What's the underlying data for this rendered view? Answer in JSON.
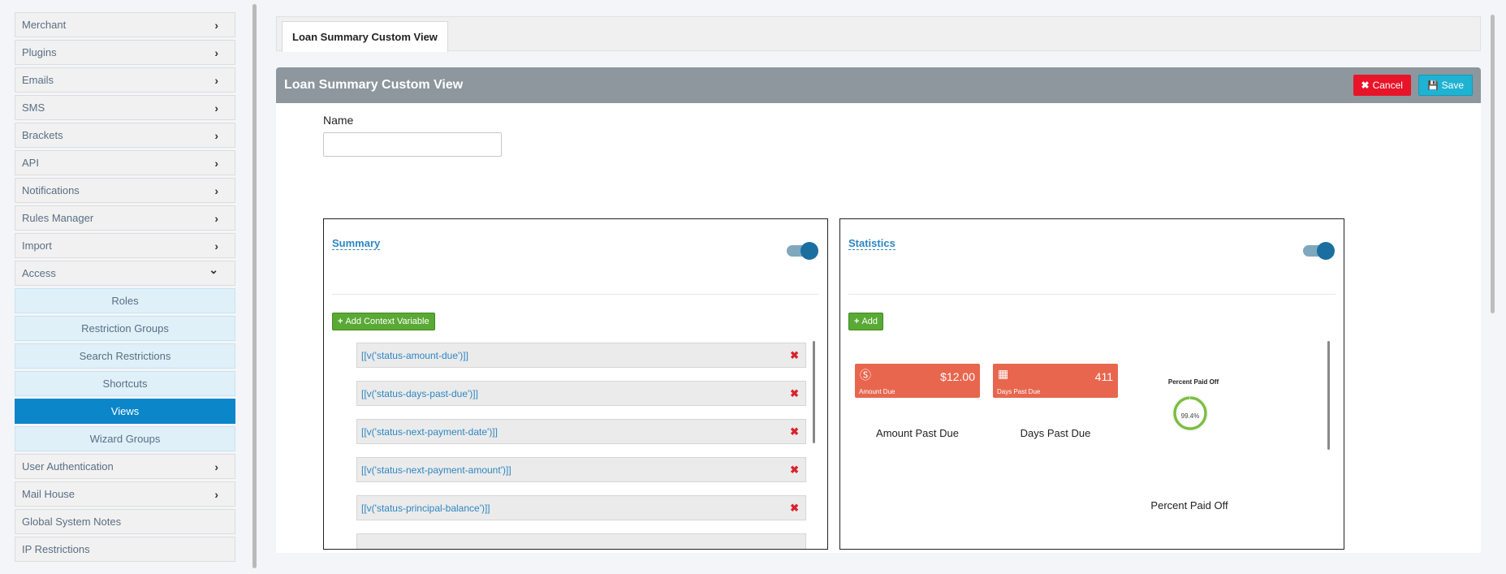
{
  "sidebar": {
    "items": [
      {
        "label": "Merchant",
        "type": "menu",
        "expand_icon": "chevron-right"
      },
      {
        "label": "Plugins",
        "type": "menu",
        "expand_icon": "chevron-right"
      },
      {
        "label": "Emails",
        "type": "menu",
        "expand_icon": "chevron-right"
      },
      {
        "label": "SMS",
        "type": "menu",
        "expand_icon": "chevron-right"
      },
      {
        "label": "Brackets",
        "type": "menu",
        "expand_icon": "chevron-right"
      },
      {
        "label": "API",
        "type": "menu",
        "expand_icon": "chevron-right"
      },
      {
        "label": "Notifications",
        "type": "menu",
        "expand_icon": "chevron-right"
      },
      {
        "label": "Rules Manager",
        "type": "menu",
        "expand_icon": "chevron-right"
      },
      {
        "label": "Import",
        "type": "menu",
        "expand_icon": "chevron-right"
      },
      {
        "label": "Access",
        "type": "menu",
        "expand_icon": "chevron-down"
      },
      {
        "label": "Roles",
        "type": "sub"
      },
      {
        "label": "Restriction Groups",
        "type": "sub"
      },
      {
        "label": "Search Restrictions",
        "type": "sub"
      },
      {
        "label": "Shortcuts",
        "type": "sub"
      },
      {
        "label": "Views",
        "type": "sub",
        "active": true
      },
      {
        "label": "Wizard Groups",
        "type": "sub"
      },
      {
        "label": "User Authentication",
        "type": "menu",
        "expand_icon": "chevron-right"
      },
      {
        "label": "Mail House",
        "type": "menu",
        "expand_icon": "chevron-right"
      },
      {
        "label": "Global System Notes",
        "type": "menu"
      },
      {
        "label": "IP Restrictions",
        "type": "menu"
      }
    ]
  },
  "tabs": [
    {
      "label": "Loan Summary Custom View",
      "active": true
    }
  ],
  "panel": {
    "title": "Loan Summary Custom View",
    "cancel_label": "Cancel",
    "save_label": "Save",
    "name_label": "Name",
    "name_value": ""
  },
  "summary": {
    "title": "Summary",
    "enabled": true,
    "add_button": "Add Context Variable",
    "variables": [
      "[[v('status-amount-due')]]",
      "[[v('status-days-past-due')]]",
      "[[v('status-next-payment-date')]]",
      "[[v('status-next-payment-amount')]]",
      "[[v('status-principal-balance')]]",
      ""
    ]
  },
  "statistics": {
    "title": "Statistics",
    "enabled": true,
    "add_button": "Add",
    "cards": [
      {
        "icon": "dollar-circle-icon",
        "value": "$12.00",
        "label": "Amount Due",
        "caption": "Amount Past Due"
      },
      {
        "icon": "calendar-icon",
        "value": "411",
        "label": "Days Past Due",
        "caption": "Days Past Due"
      }
    ],
    "gauge": {
      "title": "Percent Paid Off",
      "value": "99.4%",
      "percent": 99.4,
      "caption": "Percent Paid Off"
    }
  },
  "colors": {
    "accent_blue": "#0a86c9",
    "cancel_red": "#e8142a",
    "save_cyan": "#1fb3d3",
    "card_orange": "#e8664e",
    "add_green": "#5aa935",
    "gauge_green": "#7cbd42"
  }
}
